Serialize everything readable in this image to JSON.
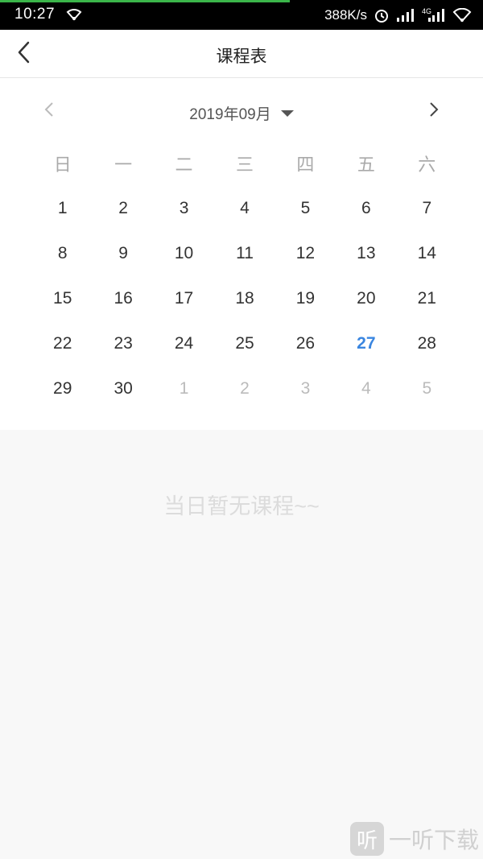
{
  "status_bar": {
    "time": "10:27",
    "net_speed": "388K/s",
    "network_type": "4G",
    "icons": [
      "wifi-icon",
      "alarm-icon",
      "signal-icon",
      "signal-4g-icon",
      "wifi-icon"
    ],
    "progress_color": "#3bb54a",
    "progress_fraction": 0.6
  },
  "app_bar": {
    "title": "课程表",
    "back_icon": "chevron-left-icon"
  },
  "calendar": {
    "month_label": "2019年09月",
    "prev_icon": "chevron-left-icon",
    "next_icon": "chevron-right-icon",
    "dropdown_icon": "caret-down-icon",
    "weekdays": [
      "日",
      "一",
      "二",
      "三",
      "四",
      "五",
      "六"
    ],
    "days": [
      {
        "d": "1",
        "state": "current"
      },
      {
        "d": "2",
        "state": "current"
      },
      {
        "d": "3",
        "state": "current"
      },
      {
        "d": "4",
        "state": "current"
      },
      {
        "d": "5",
        "state": "current"
      },
      {
        "d": "6",
        "state": "current"
      },
      {
        "d": "7",
        "state": "current"
      },
      {
        "d": "8",
        "state": "current"
      },
      {
        "d": "9",
        "state": "current"
      },
      {
        "d": "10",
        "state": "current"
      },
      {
        "d": "11",
        "state": "current"
      },
      {
        "d": "12",
        "state": "current"
      },
      {
        "d": "13",
        "state": "current"
      },
      {
        "d": "14",
        "state": "current"
      },
      {
        "d": "15",
        "state": "current"
      },
      {
        "d": "16",
        "state": "current"
      },
      {
        "d": "17",
        "state": "current"
      },
      {
        "d": "18",
        "state": "current"
      },
      {
        "d": "19",
        "state": "current"
      },
      {
        "d": "20",
        "state": "current"
      },
      {
        "d": "21",
        "state": "current"
      },
      {
        "d": "22",
        "state": "current"
      },
      {
        "d": "23",
        "state": "current"
      },
      {
        "d": "24",
        "state": "current"
      },
      {
        "d": "25",
        "state": "current"
      },
      {
        "d": "26",
        "state": "current"
      },
      {
        "d": "27",
        "state": "today"
      },
      {
        "d": "28",
        "state": "current"
      },
      {
        "d": "29",
        "state": "current"
      },
      {
        "d": "30",
        "state": "current"
      },
      {
        "d": "1",
        "state": "next"
      },
      {
        "d": "2",
        "state": "next"
      },
      {
        "d": "3",
        "state": "next"
      },
      {
        "d": "4",
        "state": "next"
      },
      {
        "d": "5",
        "state": "next"
      }
    ],
    "today_color": "#3a86e0"
  },
  "empty_message": "当日暂无课程~~",
  "watermark": {
    "logo_char": "听",
    "text": "一听下载"
  }
}
